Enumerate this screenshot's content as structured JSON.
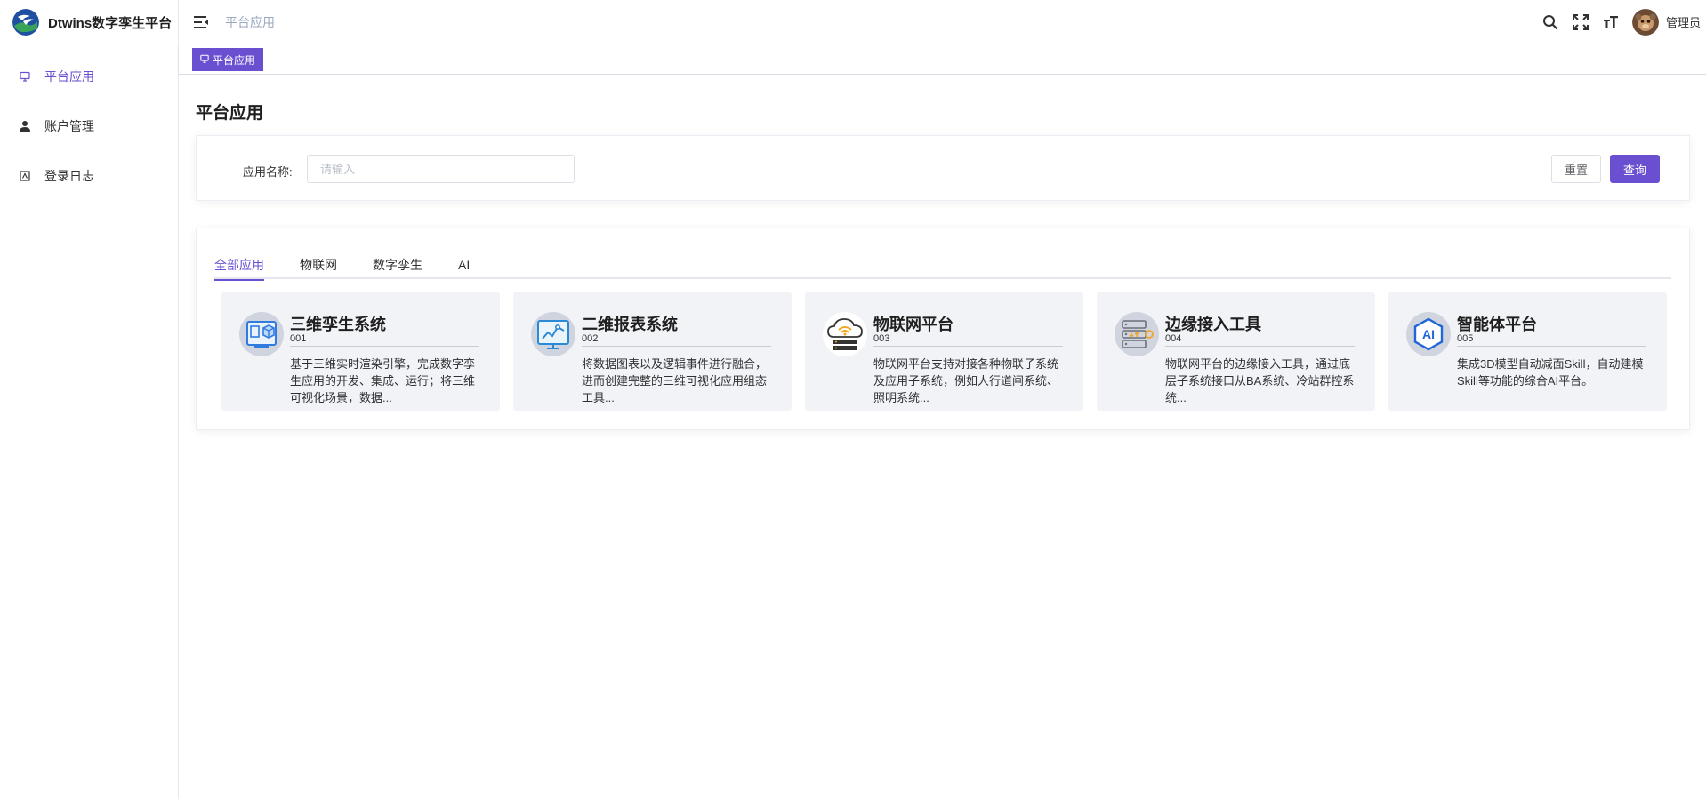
{
  "brand": {
    "title": "Dtwins数字孪生平台"
  },
  "sidebar": {
    "items": [
      {
        "label": "平台应用",
        "icon": "monitor-icon",
        "active": true
      },
      {
        "label": "账户管理",
        "icon": "user-icon",
        "active": false
      },
      {
        "label": "登录日志",
        "icon": "log-icon",
        "active": false
      }
    ]
  },
  "header": {
    "breadcrumb": "平台应用",
    "user_name": "管理员"
  },
  "tagsbar": {
    "active_tag": "平台应用"
  },
  "page": {
    "title": "平台应用"
  },
  "search": {
    "label": "应用名称:",
    "placeholder": "请输入",
    "value": "",
    "reset_label": "重置",
    "query_label": "查询"
  },
  "tabs": [
    {
      "label": "全部应用",
      "active": true
    },
    {
      "label": "物联网",
      "active": false
    },
    {
      "label": "数字孪生",
      "active": false
    },
    {
      "label": "AI",
      "active": false
    }
  ],
  "apps": [
    {
      "name": "三维孪生系统",
      "code": "001",
      "icon": "3d-twin-icon",
      "desc": "基于三维实时渲染引擎，完成数字孪生应用的开发、集成、运行；将三维可视化场景，数据..."
    },
    {
      "name": "二维报表系统",
      "code": "002",
      "icon": "chart-report-icon",
      "desc": "将数据图表以及逻辑事件进行融合，进而创建完整的三维可视化应用组态工具..."
    },
    {
      "name": "物联网平台",
      "code": "003",
      "icon": "iot-cloud-icon",
      "desc": "物联网平台支持对接各种物联子系统及应用子系统，例如人行道闸系统、照明系统..."
    },
    {
      "name": "边缘接入工具",
      "code": "004",
      "icon": "edge-server-icon",
      "desc": "物联网平台的边缘接入工具，通过底层子系统接口从BA系统、冷站群控系统..."
    },
    {
      "name": "智能体平台",
      "code": "005",
      "icon": "ai-agent-icon",
      "desc": "集成3D模型自动减面Skill，自动建模Skill等功能的综合AI平台。"
    }
  ],
  "colors": {
    "accent": "#6a4fd1",
    "card_bg": "#f2f3f7"
  }
}
